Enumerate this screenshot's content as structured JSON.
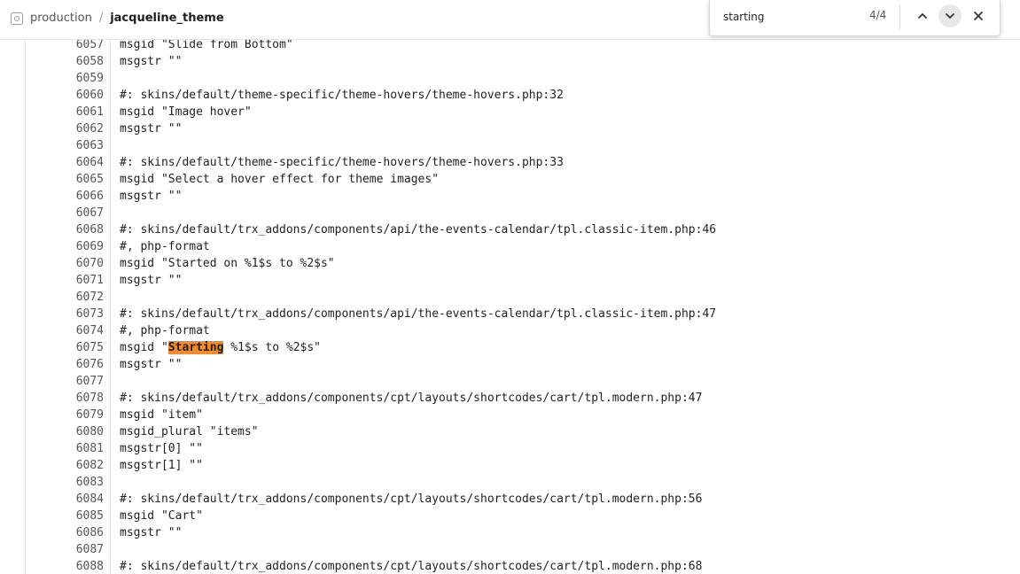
{
  "breadcrumb": {
    "root": "production",
    "separator": "/",
    "current": "jacqueline_theme"
  },
  "find": {
    "query": "starting",
    "count": "4/4"
  },
  "icons": {
    "app": "app-icon",
    "prev": "chevron-up-icon",
    "next": "chevron-down-icon",
    "close": "close-icon"
  },
  "colors": {
    "match_highlight": "#f28c28"
  },
  "code": {
    "lines": [
      {
        "n": "6057",
        "text": "msgid \"Slide from Bottom\""
      },
      {
        "n": "6058",
        "text": "msgstr \"\""
      },
      {
        "n": "6059",
        "text": ""
      },
      {
        "n": "6060",
        "text": "#: skins/default/theme-specific/theme-hovers/theme-hovers.php:32"
      },
      {
        "n": "6061",
        "text": "msgid \"Image hover\""
      },
      {
        "n": "6062",
        "text": "msgstr \"\""
      },
      {
        "n": "6063",
        "text": ""
      },
      {
        "n": "6064",
        "text": "#: skins/default/theme-specific/theme-hovers/theme-hovers.php:33"
      },
      {
        "n": "6065",
        "text": "msgid \"Select a hover effect for theme images\""
      },
      {
        "n": "6066",
        "text": "msgstr \"\""
      },
      {
        "n": "6067",
        "text": ""
      },
      {
        "n": "6068",
        "text": "#: skins/default/trx_addons/components/api/the-events-calendar/tpl.classic-item.php:46"
      },
      {
        "n": "6069",
        "text": "#, php-format"
      },
      {
        "n": "6070",
        "text": "msgid \"Started on %1$s to %2$s\""
      },
      {
        "n": "6071",
        "text": "msgstr \"\""
      },
      {
        "n": "6072",
        "text": ""
      },
      {
        "n": "6073",
        "text": "#: skins/default/trx_addons/components/api/the-events-calendar/tpl.classic-item.php:47"
      },
      {
        "n": "6074",
        "text": "#, php-format"
      },
      {
        "n": "6075",
        "pre": "msgid \"",
        "match": "Starting",
        "post": " %1$s to %2$s\""
      },
      {
        "n": "6076",
        "text": "msgstr \"\""
      },
      {
        "n": "6077",
        "text": ""
      },
      {
        "n": "6078",
        "text": "#: skins/default/trx_addons/components/cpt/layouts/shortcodes/cart/tpl.modern.php:47"
      },
      {
        "n": "6079",
        "text": "msgid \"item\""
      },
      {
        "n": "6080",
        "text": "msgid_plural \"items\""
      },
      {
        "n": "6081",
        "text": "msgstr[0] \"\""
      },
      {
        "n": "6082",
        "text": "msgstr[1] \"\""
      },
      {
        "n": "6083",
        "text": ""
      },
      {
        "n": "6084",
        "text": "#: skins/default/trx_addons/components/cpt/layouts/shortcodes/cart/tpl.modern.php:56"
      },
      {
        "n": "6085",
        "text": "msgid \"Cart\""
      },
      {
        "n": "6086",
        "text": "msgstr \"\""
      },
      {
        "n": "6087",
        "text": ""
      },
      {
        "n": "6088",
        "text": "#: skins/default/trx_addons/components/cpt/layouts/shortcodes/cart/tpl.modern.php:68"
      }
    ]
  }
}
